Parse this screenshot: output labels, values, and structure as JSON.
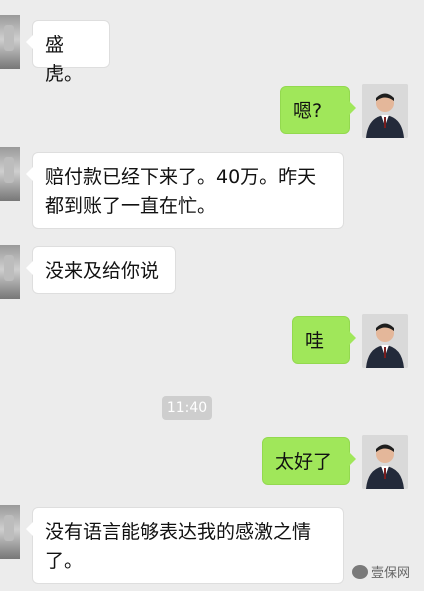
{
  "messages": [
    {
      "side": "left",
      "text": "盛虎。"
    },
    {
      "side": "right",
      "text": "嗯?"
    },
    {
      "side": "left",
      "text": "赔付款已经下来了。40万。昨天都到账了一直在忙。"
    },
    {
      "side": "left",
      "text": "没来及给你说"
    },
    {
      "side": "right",
      "text": "哇"
    },
    {
      "side": "right",
      "text": "太好了"
    },
    {
      "side": "left",
      "text": "没有语言能够表达我的感激之情了。"
    }
  ],
  "timestamp": "11:40",
  "watermark": "壹保网",
  "colors": {
    "background": "#ececec",
    "incoming_bubble": "#ffffff",
    "outgoing_bubble": "#a0e75a",
    "timestamp_pill": "#cecece"
  }
}
